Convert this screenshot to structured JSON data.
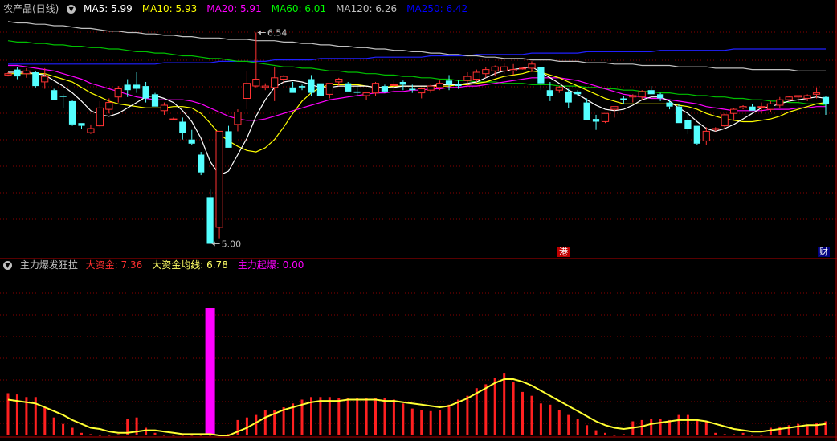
{
  "upper": {
    "title": "农产品(日线)",
    "ma_items": [
      {
        "label": "MA5: ",
        "value": "5.99",
        "color": "#ffffff"
      },
      {
        "label": "MA10: ",
        "value": "5.93",
        "color": "#ffff00"
      },
      {
        "label": "MA20: ",
        "value": "5.91",
        "color": "#ff00ff"
      },
      {
        "label": "MA60: ",
        "value": "6.01",
        "color": "#00ff00"
      },
      {
        "label": "MA120: ",
        "value": "6.26",
        "color": "#c0c0c0"
      },
      {
        "label": "MA250: ",
        "value": "6.42",
        "color": "#0000ff"
      }
    ],
    "high_label": "6.54",
    "low_label": "5.00",
    "tag_hk": "港",
    "tag_cai": "财"
  },
  "lower": {
    "title": "主力爆发狂拉",
    "items": [
      {
        "label": "大资金: ",
        "value": "7.36",
        "color": "#ff3030"
      },
      {
        "label": "大资金均线: ",
        "value": "6.78",
        "color": "#ffff66"
      },
      {
        "label": "主力起爆: ",
        "value": "0.00",
        "color": "#ff00ff"
      }
    ]
  },
  "chart_data": [
    {
      "type": "candlestick",
      "ylim": [
        4.95,
        6.66
      ],
      "high_marker": 6.54,
      "low_marker": 5.0,
      "ohlc": [
        [
          6.23,
          6.25,
          6.22,
          6.24
        ],
        [
          6.27,
          6.29,
          6.2,
          6.22
        ],
        [
          6.24,
          6.28,
          6.21,
          6.26
        ],
        [
          6.25,
          6.26,
          6.14,
          6.15
        ],
        [
          6.18,
          6.28,
          6.13,
          6.22
        ],
        [
          6.12,
          6.13,
          6.05,
          6.05
        ],
        [
          6.08,
          6.09,
          5.99,
          6.07
        ],
        [
          6.04,
          6.05,
          5.86,
          5.87
        ],
        [
          5.88,
          5.88,
          5.84,
          5.86
        ],
        [
          5.81,
          5.87,
          5.8,
          5.84
        ],
        [
          5.86,
          6.04,
          5.85,
          5.99
        ],
        [
          5.98,
          6.06,
          5.95,
          6.03
        ],
        [
          6.07,
          6.15,
          6.03,
          6.13
        ],
        [
          6.16,
          6.2,
          6.07,
          6.12
        ],
        [
          6.16,
          6.25,
          6.1,
          6.13
        ],
        [
          6.15,
          6.18,
          6.03,
          6.06
        ],
        [
          6.09,
          6.1,
          6.0,
          6.0
        ],
        [
          5.97,
          6.03,
          5.94,
          6.01
        ],
        [
          5.91,
          5.92,
          5.91,
          5.91
        ],
        [
          5.89,
          5.92,
          5.76,
          5.81
        ],
        [
          5.76,
          5.83,
          5.72,
          5.73
        ],
        [
          5.65,
          5.67,
          5.5,
          5.52
        ],
        [
          5.34,
          5.4,
          5.02,
          5.0
        ],
        [
          5.12,
          5.65,
          5.04,
          5.82
        ],
        [
          5.82,
          5.86,
          5.7,
          5.7
        ],
        [
          5.87,
          5.98,
          5.82,
          5.96
        ],
        [
          6.06,
          6.26,
          5.98,
          6.17
        ],
        [
          6.15,
          6.54,
          6.14,
          6.2
        ],
        [
          6.14,
          6.17,
          6.12,
          6.15
        ],
        [
          6.14,
          6.29,
          6.04,
          6.21
        ],
        [
          6.2,
          6.23,
          6.17,
          6.22
        ],
        [
          6.14,
          6.18,
          6.1,
          6.1
        ],
        [
          6.15,
          6.16,
          6.12,
          6.14
        ],
        [
          6.2,
          6.23,
          6.08,
          6.1
        ],
        [
          6.17,
          6.17,
          6.08,
          6.08
        ],
        [
          6.09,
          6.16,
          6.06,
          6.17
        ],
        [
          6.18,
          6.21,
          6.15,
          6.2
        ],
        [
          6.17,
          6.18,
          6.11,
          6.11
        ],
        [
          6.11,
          6.15,
          6.08,
          6.1
        ],
        [
          6.08,
          6.1,
          6.05,
          6.1
        ],
        [
          6.1,
          6.18,
          6.08,
          6.17
        ],
        [
          6.15,
          6.16,
          6.1,
          6.11
        ],
        [
          6.16,
          6.19,
          6.11,
          6.16
        ],
        [
          6.18,
          6.19,
          6.12,
          6.16
        ],
        [
          6.13,
          6.16,
          6.1,
          6.12
        ],
        [
          6.1,
          6.13,
          6.06,
          6.13
        ],
        [
          6.12,
          6.16,
          6.1,
          6.15
        ],
        [
          6.14,
          6.19,
          6.12,
          6.17
        ],
        [
          6.19,
          6.23,
          6.12,
          6.16
        ],
        [
          6.16,
          6.19,
          6.13,
          6.15
        ],
        [
          6.19,
          6.25,
          6.15,
          6.22
        ],
        [
          6.2,
          6.27,
          6.18,
          6.25
        ],
        [
          6.24,
          6.29,
          6.21,
          6.27
        ],
        [
          6.26,
          6.3,
          6.22,
          6.29
        ],
        [
          6.26,
          6.32,
          6.24,
          6.29
        ],
        [
          6.26,
          6.31,
          6.23,
          6.27
        ],
        [
          6.28,
          6.29,
          6.27,
          6.28
        ],
        [
          6.28,
          6.33,
          6.25,
          6.31
        ],
        [
          6.29,
          6.29,
          6.12,
          6.17
        ],
        [
          6.12,
          6.18,
          6.04,
          6.08
        ],
        [
          6.12,
          6.15,
          6.1,
          6.14
        ],
        [
          6.11,
          6.13,
          5.99,
          6.03
        ],
        [
          6.11,
          6.12,
          6.08,
          6.09
        ],
        [
          6.03,
          6.06,
          5.9,
          5.9
        ],
        [
          5.91,
          5.94,
          5.83,
          5.89
        ],
        [
          5.89,
          5.95,
          5.88,
          5.95
        ],
        [
          5.98,
          6.0,
          5.92,
          6.0
        ],
        [
          6.06,
          6.08,
          6.02,
          6.05
        ],
        [
          6.07,
          6.09,
          6.03,
          6.08
        ],
        [
          6.07,
          6.12,
          6.05,
          6.11
        ],
        [
          6.12,
          6.15,
          6.09,
          6.09
        ],
        [
          6.09,
          6.1,
          6.04,
          6.06
        ],
        [
          6.03,
          6.05,
          5.98,
          6.0
        ],
        [
          6.0,
          6.02,
          5.88,
          5.88
        ],
        [
          5.9,
          5.95,
          5.8,
          5.84
        ],
        [
          5.86,
          5.86,
          5.72,
          5.73
        ],
        [
          5.75,
          5.85,
          5.72,
          5.82
        ],
        [
          5.84,
          5.85,
          5.82,
          5.84
        ],
        [
          5.86,
          5.95,
          5.84,
          5.94
        ],
        [
          5.95,
          5.99,
          5.9,
          5.98
        ],
        [
          5.99,
          6.01,
          5.98,
          6.0
        ],
        [
          6.0,
          6.02,
          5.97,
          5.97
        ],
        [
          6.0,
          6.03,
          5.95,
          6.0
        ],
        [
          5.98,
          6.04,
          5.96,
          6.02
        ],
        [
          6.01,
          6.07,
          5.99,
          6.05
        ],
        [
          6.05,
          6.08,
          6.04,
          6.07
        ],
        [
          6.07,
          6.08,
          6.03,
          6.08
        ],
        [
          6.06,
          6.09,
          6.04,
          6.08
        ],
        [
          6.09,
          6.14,
          6.06,
          6.1
        ],
        [
          6.07,
          6.08,
          5.94,
          6.02
        ]
      ],
      "ma5": [
        6.25,
        6.25,
        6.25,
        6.24,
        6.23,
        6.19,
        6.15,
        6.1,
        6.04,
        5.97,
        5.94,
        5.93,
        5.95,
        5.99,
        6.03,
        6.07,
        6.08,
        6.06,
        6.03,
        5.97,
        5.89,
        5.77,
        5.6,
        5.5,
        5.53,
        5.65,
        5.77,
        5.93,
        6.05,
        6.14,
        6.18,
        6.19,
        6.18,
        6.16,
        6.14,
        6.14,
        6.15,
        6.15,
        6.15,
        6.15,
        6.14,
        6.14,
        6.14,
        6.15,
        6.15,
        6.15,
        6.15,
        6.16,
        6.16,
        6.16,
        6.17,
        6.18,
        6.21,
        6.24,
        6.26,
        6.27,
        6.28,
        6.29,
        6.25,
        6.21,
        6.17,
        6.12,
        6.09,
        6.05,
        6.01,
        5.98,
        5.97,
        5.98,
        6.01,
        6.05,
        6.07,
        6.07,
        6.04,
        5.99,
        5.95,
        5.89,
        5.84,
        5.82,
        5.84,
        5.87,
        5.91,
        5.95,
        5.99,
        6.0,
        6.02,
        6.04,
        6.05,
        6.06,
        6.07,
        6.06
      ],
      "ma10": [
        6.24,
        6.24,
        6.24,
        6.24,
        6.24,
        6.22,
        6.2,
        6.18,
        6.14,
        6.1,
        6.07,
        6.04,
        6.02,
        6.01,
        6.0,
        5.99,
        5.99,
        5.99,
        6.0,
        6.0,
        5.99,
        5.95,
        5.88,
        5.8,
        5.75,
        5.71,
        5.68,
        5.67,
        5.7,
        5.76,
        5.85,
        5.95,
        6.04,
        6.1,
        6.14,
        6.16,
        6.16,
        6.16,
        6.16,
        6.15,
        6.14,
        6.14,
        6.15,
        6.15,
        6.15,
        6.15,
        6.15,
        6.15,
        6.15,
        6.16,
        6.16,
        6.17,
        6.18,
        6.2,
        6.22,
        6.23,
        6.24,
        6.26,
        6.25,
        6.23,
        6.21,
        6.18,
        6.15,
        6.12,
        6.09,
        6.06,
        6.04,
        6.02,
        6.02,
        6.02,
        6.02,
        6.02,
        6.02,
        6.01,
        6.0,
        5.98,
        5.95,
        5.93,
        5.91,
        5.9,
        5.89,
        5.89,
        5.9,
        5.91,
        5.93,
        5.96,
        5.98,
        6.0,
        6.02,
        6.03
      ],
      "ma20": [
        6.3,
        6.3,
        6.29,
        6.28,
        6.27,
        6.26,
        6.24,
        6.22,
        6.2,
        6.17,
        6.15,
        6.13,
        6.11,
        6.09,
        6.07,
        6.06,
        6.05,
        6.05,
        6.05,
        6.05,
        6.04,
        6.02,
        5.99,
        5.96,
        5.93,
        5.91,
        5.9,
        5.9,
        5.91,
        5.93,
        5.95,
        5.97,
        5.99,
        6.01,
        6.03,
        6.05,
        6.06,
        6.07,
        6.08,
        6.09,
        6.1,
        6.1,
        6.11,
        6.11,
        6.12,
        6.12,
        6.13,
        6.13,
        6.14,
        6.14,
        6.15,
        6.15,
        6.16,
        6.17,
        6.18,
        6.19,
        6.2,
        6.21,
        6.21,
        6.21,
        6.21,
        6.2,
        6.19,
        6.17,
        6.15,
        6.13,
        6.11,
        6.09,
        6.08,
        6.07,
        6.06,
        6.06,
        6.05,
        6.04,
        6.03,
        6.02,
        6.0,
        5.99,
        5.98,
        5.97,
        5.97,
        5.97,
        5.97,
        5.98,
        5.98,
        5.98,
        5.99,
        5.99,
        6.0,
        6.0
      ],
      "ma60": [
        6.48,
        6.47,
        6.47,
        6.46,
        6.46,
        6.45,
        6.45,
        6.44,
        6.44,
        6.43,
        6.43,
        6.42,
        6.42,
        6.41,
        6.4,
        6.4,
        6.39,
        6.39,
        6.38,
        6.37,
        6.37,
        6.36,
        6.35,
        6.35,
        6.34,
        6.33,
        6.33,
        6.32,
        6.31,
        6.3,
        6.29,
        6.29,
        6.28,
        6.28,
        6.27,
        6.26,
        6.26,
        6.25,
        6.25,
        6.24,
        6.24,
        6.23,
        6.23,
        6.22,
        6.22,
        6.21,
        6.21,
        6.2,
        6.2,
        6.19,
        6.19,
        6.18,
        6.18,
        6.18,
        6.17,
        6.17,
        6.17,
        6.16,
        6.16,
        6.16,
        6.15,
        6.15,
        6.15,
        6.14,
        6.14,
        6.13,
        6.13,
        6.12,
        6.12,
        6.11,
        6.11,
        6.1,
        6.1,
        6.09,
        6.09,
        6.08,
        6.08,
        6.07,
        6.07,
        6.06,
        6.06,
        6.05,
        6.05,
        6.04,
        6.04,
        6.03,
        6.03,
        6.02,
        6.02,
        6.01
      ],
      "ma120": [
        6.62,
        6.61,
        6.61,
        6.6,
        6.6,
        6.59,
        6.59,
        6.58,
        6.57,
        6.57,
        6.56,
        6.55,
        6.55,
        6.54,
        6.54,
        6.53,
        6.53,
        6.52,
        6.52,
        6.51,
        6.51,
        6.5,
        6.5,
        6.5,
        6.49,
        6.49,
        6.49,
        6.48,
        6.48,
        6.48,
        6.47,
        6.47,
        6.46,
        6.46,
        6.45,
        6.45,
        6.44,
        6.44,
        6.43,
        6.43,
        6.42,
        6.42,
        6.41,
        6.41,
        6.4,
        6.4,
        6.39,
        6.39,
        6.38,
        6.38,
        6.37,
        6.37,
        6.36,
        6.36,
        6.35,
        6.35,
        6.35,
        6.34,
        6.34,
        6.34,
        6.33,
        6.33,
        6.33,
        6.32,
        6.32,
        6.32,
        6.31,
        6.31,
        6.31,
        6.3,
        6.3,
        6.3,
        6.3,
        6.29,
        6.29,
        6.29,
        6.29,
        6.28,
        6.28,
        6.28,
        6.28,
        6.27,
        6.27,
        6.27,
        6.27,
        6.27,
        6.26,
        6.26,
        6.26,
        6.26
      ],
      "ma250": [
        6.31,
        6.31,
        6.31,
        6.31,
        6.31,
        6.31,
        6.31,
        6.31,
        6.31,
        6.31,
        6.31,
        6.31,
        6.31,
        6.31,
        6.31,
        6.31,
        6.31,
        6.32,
        6.32,
        6.32,
        6.32,
        6.32,
        6.32,
        6.33,
        6.33,
        6.33,
        6.33,
        6.33,
        6.33,
        6.34,
        6.34,
        6.34,
        6.34,
        6.34,
        6.35,
        6.35,
        6.35,
        6.35,
        6.35,
        6.35,
        6.36,
        6.36,
        6.36,
        6.36,
        6.36,
        6.36,
        6.37,
        6.37,
        6.37,
        6.37,
        6.37,
        6.38,
        6.38,
        6.38,
        6.38,
        6.38,
        6.38,
        6.39,
        6.39,
        6.39,
        6.39,
        6.39,
        6.39,
        6.4,
        6.4,
        6.4,
        6.4,
        6.4,
        6.4,
        6.4,
        6.4,
        6.41,
        6.41,
        6.41,
        6.41,
        6.41,
        6.41,
        6.41,
        6.41,
        6.42,
        6.42,
        6.42,
        6.42,
        6.42,
        6.42,
        6.42,
        6.42,
        6.42,
        6.42,
        6.42
      ]
    },
    {
      "type": "bar",
      "ylim": [
        0,
        100
      ],
      "dazijin": [
        33,
        32,
        30,
        30,
        22,
        14,
        9,
        6,
        2,
        1,
        0,
        0,
        1,
        13,
        14,
        6,
        2,
        0,
        0,
        0,
        0,
        0,
        0,
        0,
        1,
        12,
        14,
        16,
        20,
        20,
        22,
        25,
        28,
        30,
        30,
        30,
        29,
        29,
        29,
        29,
        29,
        29,
        28,
        25,
        21,
        20,
        19,
        20,
        24,
        28,
        31,
        37,
        40,
        45,
        49,
        42,
        34,
        31,
        25,
        24,
        20,
        16,
        13,
        8,
        4,
        2,
        0,
        1,
        11,
        12,
        13,
        13,
        12,
        16,
        16,
        12,
        11,
        2,
        1,
        1,
        2,
        0,
        0,
        6,
        7,
        8,
        9,
        8,
        10,
        11
      ],
      "dazijin_ma": [
        28,
        27,
        26,
        25,
        22,
        19,
        16,
        12,
        9,
        6,
        5,
        3,
        2,
        2,
        3,
        4,
        4,
        3,
        2,
        1,
        1,
        1,
        1,
        0,
        0,
        3,
        6,
        10,
        14,
        17,
        20,
        22,
        24,
        26,
        27,
        27,
        27,
        28,
        28,
        28,
        28,
        27,
        27,
        26,
        25,
        24,
        23,
        22,
        23,
        26,
        29,
        33,
        37,
        41,
        44,
        44,
        42,
        39,
        35,
        31,
        27,
        23,
        19,
        15,
        11,
        8,
        6,
        5,
        6,
        7,
        9,
        10,
        11,
        12,
        12,
        12,
        11,
        9,
        7,
        5,
        4,
        3,
        3,
        4,
        5,
        6,
        7,
        8,
        8,
        9
      ],
      "zhuli_qibao_index": 22,
      "zhuli_qibao_value": 100
    }
  ]
}
